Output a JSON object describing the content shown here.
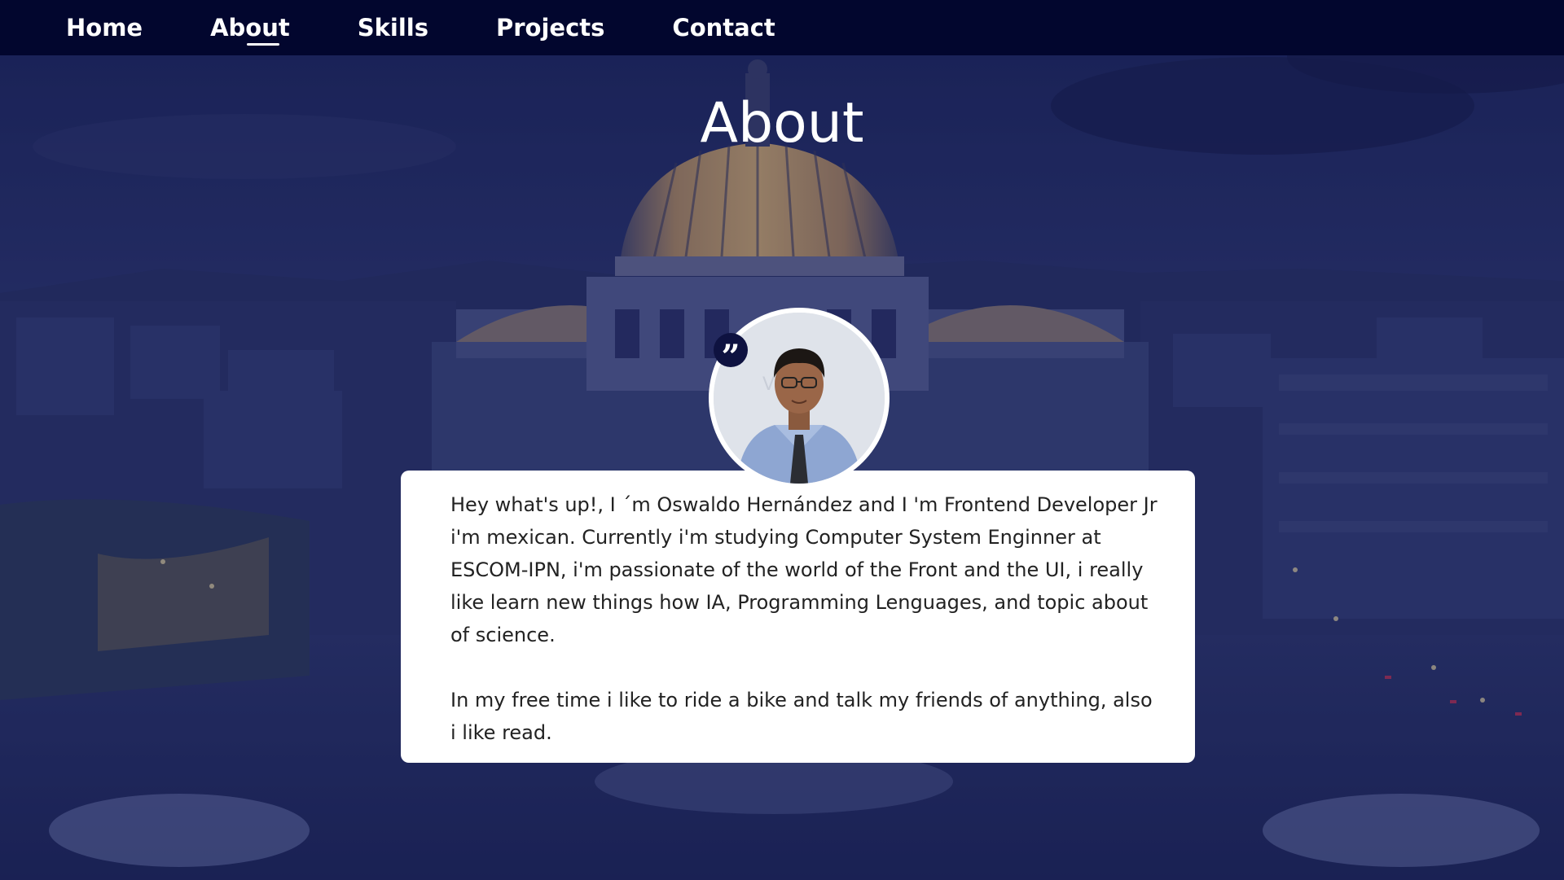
{
  "nav": {
    "items": [
      {
        "label": "Home"
      },
      {
        "label": "About"
      },
      {
        "label": "Skills"
      },
      {
        "label": "Projects"
      },
      {
        "label": "Contact"
      }
    ],
    "active": "About",
    "background": "#02062e"
  },
  "hero": {
    "title": "About",
    "background_description_color": "#1a2450"
  },
  "about": {
    "paragraph_1": "Hey what's up!, I ´m Oswaldo Hernández and I 'm Frontend Developer Jr i'm mexican. Currently i'm studying Computer  System Enginner at ESCOM-IPN, i'm passionate of the world of the Front and the UI, i really like learn new things how IA, Programming Lenguages, and topic about of science.",
    "paragraph_2": "In my free time i like to ride a bike and talk my friends of anything, also i like read.",
    "quote_glyph": "”",
    "avatar_icon": "profile-photo"
  },
  "colors": {
    "navbar": "#02062e",
    "card": "#ffffff",
    "text": "#222222",
    "quote_badge": "#0e1240"
  }
}
